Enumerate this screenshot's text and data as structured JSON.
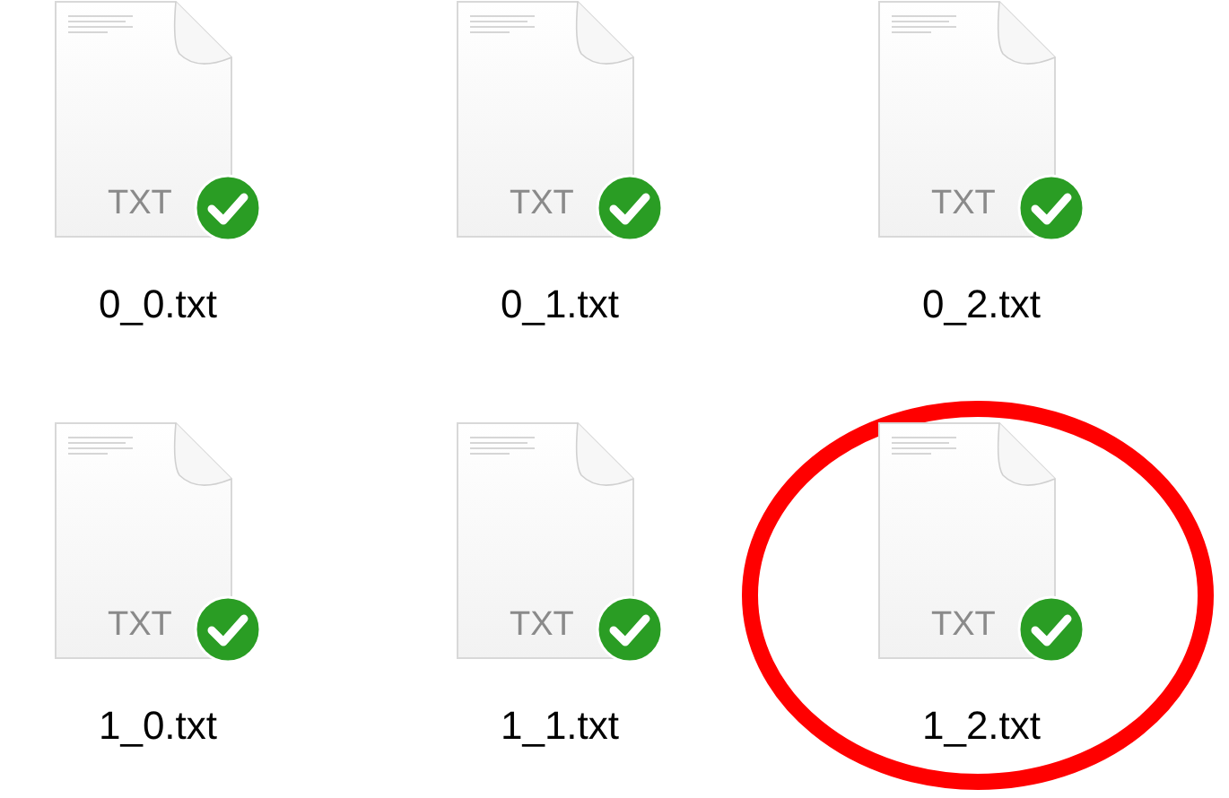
{
  "files": [
    {
      "name": "0_0.txt",
      "type_label": "TXT",
      "synced": true,
      "highlighted": false
    },
    {
      "name": "0_1.txt",
      "type_label": "TXT",
      "synced": true,
      "highlighted": false
    },
    {
      "name": "0_2.txt",
      "type_label": "TXT",
      "synced": true,
      "highlighted": false
    },
    {
      "name": "1_0.txt",
      "type_label": "TXT",
      "synced": true,
      "highlighted": false
    },
    {
      "name": "1_1.txt",
      "type_label": "TXT",
      "synced": true,
      "highlighted": false
    },
    {
      "name": "1_2.txt",
      "type_label": "TXT",
      "synced": true,
      "highlighted": true
    }
  ]
}
